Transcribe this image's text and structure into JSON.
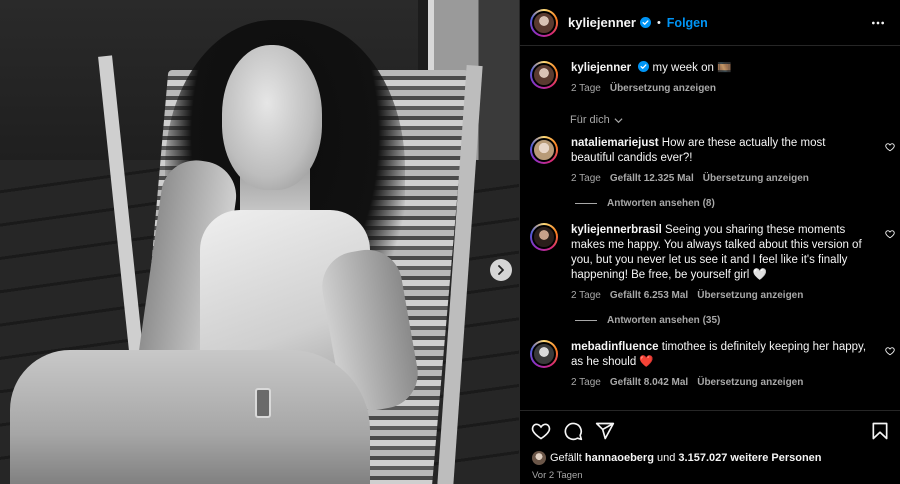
{
  "post": {
    "author": "kyliejenner",
    "follow_label": "Folgen",
    "separator": "•",
    "carousel_next": "next"
  },
  "caption": {
    "username": "kyliejenner",
    "text": "my week on 🎞️",
    "age": "2 Tage",
    "translate": "Übersetzung anzeigen"
  },
  "filter_label": "Für dich",
  "comments": [
    {
      "username": "nataliemariejust",
      "text": "How are these actually the most beautiful candids ever?!",
      "age": "2 Tage",
      "likes": "Gefällt 12.325 Mal",
      "translate": "Übersetzung anzeigen",
      "replies": "Antworten ansehen (8)"
    },
    {
      "username": "kyliejennerbrasil",
      "text": "Seeing you sharing these moments makes me happy. You always talked about this version of you, but you never let us see it and I feel like it's finally happening! Be free, be yourself girl 🤍",
      "age": "2 Tage",
      "likes": "Gefällt 6.253 Mal",
      "translate": "Übersetzung anzeigen",
      "replies": "Antworten ansehen (35)"
    },
    {
      "username": "mebadinfluence",
      "text": "timothee is definitely keeping her happy, as he should ❤️",
      "age": "2 Tage",
      "likes": "Gefällt 8.042 Mal",
      "translate": "Übersetzung anzeigen"
    }
  ],
  "likes_summary": {
    "prefix": "Gefällt",
    "user": "hannaoeberg",
    "middle": "und",
    "count": "3.157.027 weitere Personen"
  },
  "posted_time": "Vor 2 Tagen",
  "icons": {
    "like": "heart-icon",
    "comment": "comment-icon",
    "share": "share-icon",
    "save": "bookmark-icon",
    "more": "more-icon",
    "verified": "verified-badge-icon"
  },
  "colors": {
    "background": "#000000",
    "link": "#0095f6",
    "secondary_text": "#a8a8a8",
    "verified": "#0095f6"
  }
}
